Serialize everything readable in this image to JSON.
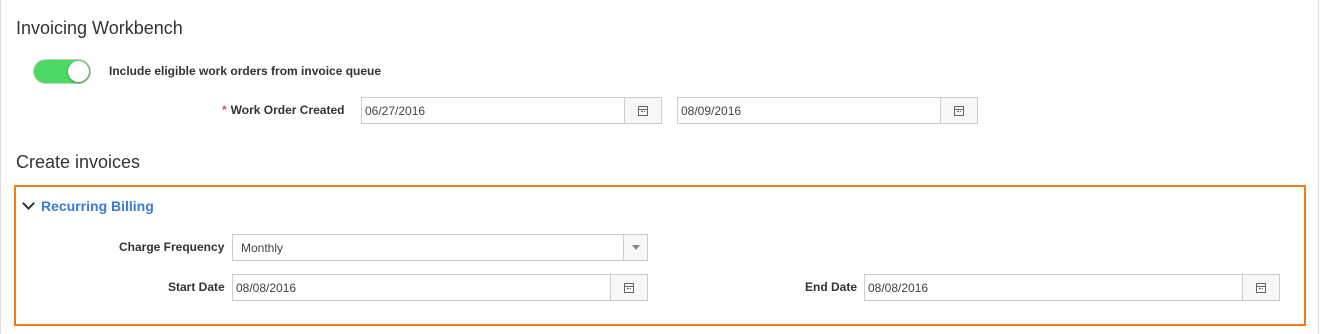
{
  "workbench": {
    "title": "Invoicing Workbench",
    "toggle_label": "Include eligible work orders from invoice queue",
    "toggle_on": true,
    "work_order_created_label": "Work Order Created",
    "required_marker": "*",
    "date_from": "06/27/2016",
    "date_to": "08/09/2016"
  },
  "create": {
    "title": "Create invoices",
    "section_title": "Recurring Billing",
    "charge_frequency_label": "Charge Frequency",
    "charge_frequency_value": "Monthly",
    "start_date_label": "Start Date",
    "start_date_value": "08/08/2016",
    "end_date_label": "End Date",
    "end_date_value": "08/08/2016"
  },
  "colors": {
    "toggle_on": "#4cd964",
    "accent_orange": "#f07c1a",
    "link_blue": "#3a7bd5",
    "required_red": "#d9534f"
  },
  "icons": [
    "calendar-icon",
    "chevron-down-icon",
    "caret-down-icon"
  ]
}
